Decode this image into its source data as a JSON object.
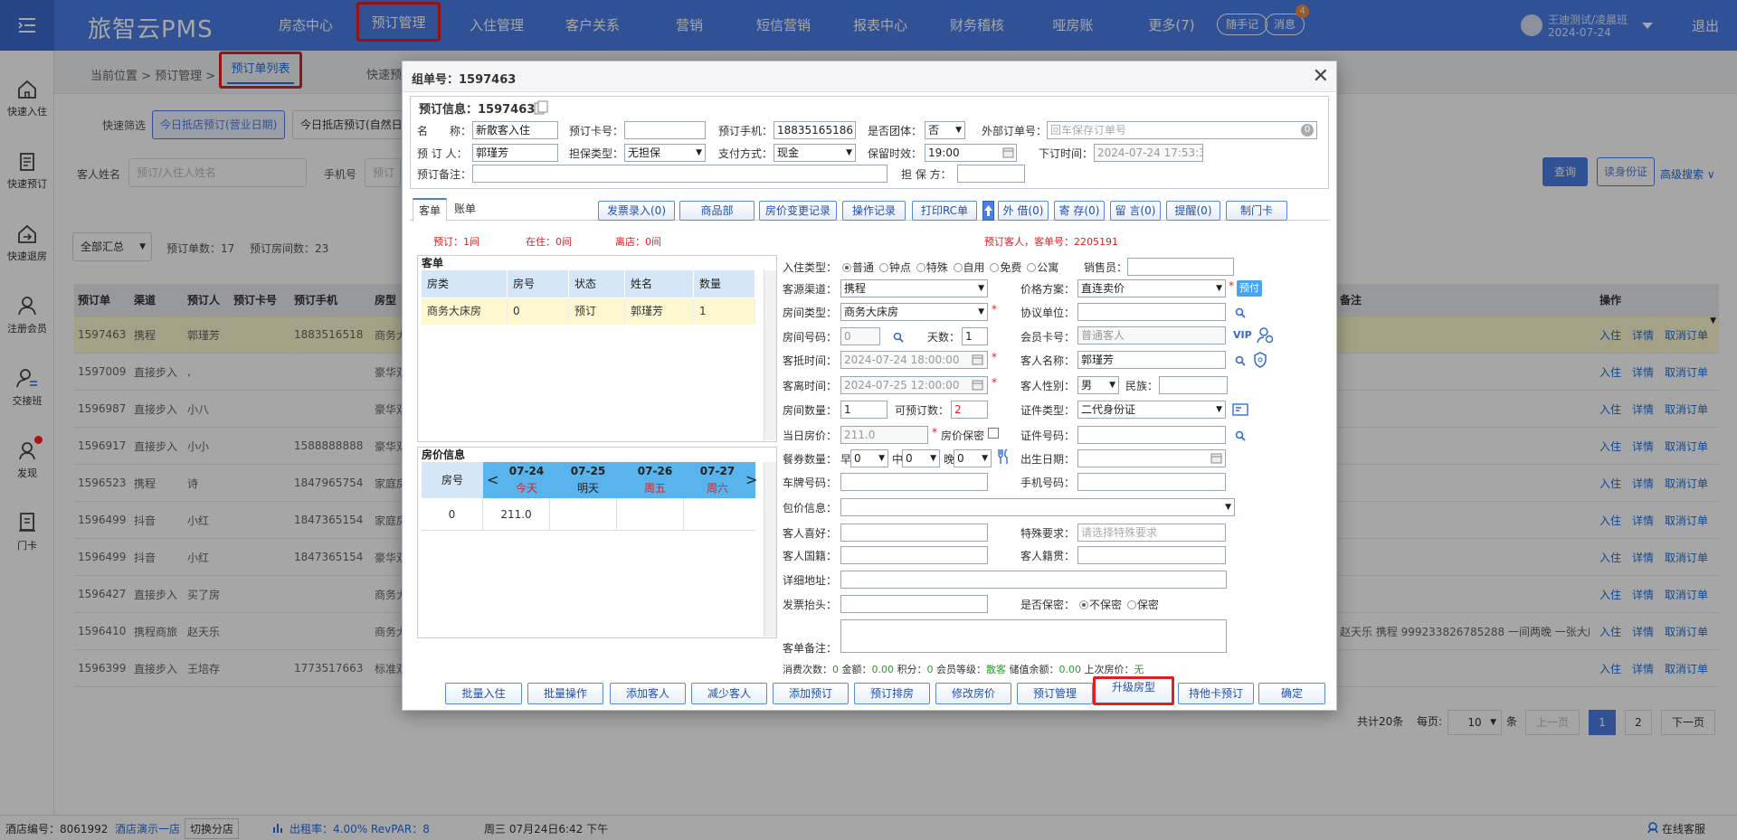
{
  "topbar": {
    "brand": "旅智云PMS",
    "nav": [
      "房态中心",
      "预订管理",
      "入住管理",
      "客户关系",
      "营销",
      "短信营销",
      "报表中心",
      "财务稽核",
      "哑房账",
      "更多(7)"
    ],
    "notes_btn": "随手记",
    "msg_btn": "消息",
    "msg_count": "4",
    "user_name": "王迪测试/凌晨班",
    "user_date": "2024-07-24",
    "logout": "退出"
  },
  "sidebar": {
    "items": [
      "快速入住",
      "快速预订",
      "快速退房",
      "注册会员",
      "交接班",
      "发现",
      "门卡"
    ]
  },
  "crumb": {
    "text": "当前位置 > 预订管理 >",
    "tab_active": "预订单列表",
    "tab2": "快速预"
  },
  "filters": {
    "quick_label": "快速筛选",
    "btn1": "今日抵店预订(营业日期)",
    "btn2": "今日抵店预订(自然日",
    "name_label": "客人姓名",
    "name_ph": "预订/入住人姓名",
    "phone_label": "手机号",
    "phone_ph": "预订",
    "query": "查询",
    "read_id": "读身份证",
    "advanced": "高级搜索 ∨",
    "summary_select": "全部汇总",
    "order_count": "预订单数：17",
    "room_count": "预订房间数：23"
  },
  "table": {
    "headers": [
      "预订单",
      "渠道",
      "预订人",
      "预订卡号",
      "预订手机",
      "房型"
    ],
    "remark_header": "备注",
    "ops_header": "操作",
    "actions": [
      "入住",
      "详情",
      "取消订单"
    ],
    "rows": [
      {
        "id": "1597463",
        "ch": "携程",
        "who": "郭瑾芳",
        "card": "",
        "phone": "18835165186",
        "type": "商务大",
        "remark": ""
      },
      {
        "id": "1597009",
        "ch": "直接步入",
        "who": ",",
        "card": "",
        "phone": "",
        "type": "豪华双",
        "remark": ""
      },
      {
        "id": "1596987",
        "ch": "直接步入",
        "who": "小八",
        "card": "",
        "phone": "",
        "type": "豪华双",
        "remark": ""
      },
      {
        "id": "1596917",
        "ch": "直接步入",
        "who": "小小",
        "card": "",
        "phone": "15888888888",
        "type": "豪华双",
        "remark": ""
      },
      {
        "id": "1596523",
        "ch": "携程",
        "who": "诗",
        "card": "",
        "phone": "18479657542",
        "type": "家庭房",
        "remark": ""
      },
      {
        "id": "1596499",
        "ch": "抖音",
        "who": "小红",
        "card": "",
        "phone": "18473651542",
        "type": "家庭房",
        "remark": ""
      },
      {
        "id": "1596499",
        "ch": "抖音",
        "who": "小红",
        "card": "",
        "phone": "18473651542",
        "type": "豪华双",
        "remark": ""
      },
      {
        "id": "1596427",
        "ch": "直接步入",
        "who": "买了房",
        "card": "",
        "phone": "",
        "type": "商务大",
        "remark": ""
      },
      {
        "id": "1596410",
        "ch": "携程商旅",
        "who": "赵天乐",
        "card": "",
        "phone": "",
        "type": "商务大",
        "remark": "赵天乐 携程 999233826785288 一间两晚 一张大床..."
      },
      {
        "id": "1596399",
        "ch": "直接步入",
        "who": "王培存",
        "card": "",
        "phone": "17735176632",
        "type": "标准双",
        "remark": ""
      }
    ]
  },
  "pager": {
    "total": "共计20条",
    "per_page_label": "每页:",
    "per_page": "10",
    "unit": "条",
    "prev": "上一页",
    "p1": "1",
    "p2": "2",
    "next": "下一页"
  },
  "statusbar": {
    "hotel_id": "酒店编号：8061992",
    "hotel_name": "酒店演示一店",
    "switch": "切换分店",
    "occupancy": "出租率：4.00% RevPAR：8",
    "datetime": "周三 07月24日6:42 下午",
    "service": "在线客服"
  },
  "modal": {
    "title": "组单号：1597463",
    "section_title": "预订信息：1597463",
    "f_name_label": "名　　称：",
    "f_name": "新散客入住",
    "f_card_label": "预订卡号：",
    "f_card": "",
    "f_phone_label": "预订手机：",
    "f_phone": "18835165186",
    "f_group_label": "是否团体：",
    "f_group": "否",
    "f_ext_label": "外部订单号：",
    "f_ext_ph": "回车保存订单号",
    "f_ext_count": "0",
    "f_booker_label": "预 订 人：",
    "f_booker": "郭瑾芳",
    "f_guar_label": "担保类型：",
    "f_guar": "无担保",
    "f_pay_label": "支付方式：",
    "f_pay": "现金",
    "f_keep_label": "保留时效：",
    "f_keep": "19:00",
    "f_ordertime_label": "下订时间：",
    "f_ordertime": "2024-07-24 17:53:3",
    "f_remark_label": "预订备注：",
    "f_guarantor_label": "担 保 方：",
    "tabs": [
      "客单",
      "账单"
    ],
    "toolbar": [
      "发票录入(0)",
      "商品部",
      "房价变更记录",
      "操作记录",
      "打印RC单",
      "外 借(0)",
      "寄 存(0)",
      "留 言(0)",
      "提醒(0)",
      "制门卡"
    ],
    "counts": {
      "booked": "预订：1间",
      "inhouse": "在住：0间",
      "left": "离店：0间",
      "guest_no": "预订客人，客单号：2205191"
    },
    "guest_panel_title": "客单",
    "guest_headers": [
      "房类",
      "房号",
      "状态",
      "姓名",
      "数量"
    ],
    "guest_row": [
      "商务大床房",
      "0",
      "预订",
      "郭瑾芳",
      "1"
    ],
    "price_panel_title": "房价信息",
    "price_head": {
      "room": "房号",
      "d1": "07-24",
      "d1s": "今天",
      "d2": "07-25",
      "d2s": "明天",
      "d3": "07-26",
      "d3s": "周五",
      "d4": "07-27",
      "d4s": "周六"
    },
    "price_row": {
      "room": "0",
      "p1": "211.0"
    },
    "r": {
      "checkin_type_label": "入住类型：",
      "checkin_types": [
        "普通",
        "钟点",
        "特殊",
        "自用",
        "免费",
        "公寓"
      ],
      "sales_label": "销售员：",
      "source_label": "客源渠道：",
      "source": "携程",
      "plan_label": "价格方案：",
      "plan": "直连卖价",
      "prepay": "预付",
      "roomtype_label": "房间类型：",
      "roomtype": "商务大床房",
      "corp_label": "协议单位：",
      "roomno_label": "房间号码：",
      "roomno": "0",
      "days_label": "天数：",
      "days": "1",
      "member_label": "会员卡号：",
      "member_ph": "普通客人",
      "arrive_label": "客抵时间：",
      "arrive": "2024-07-24 18:00:00",
      "gname_label": "客人名称：",
      "gname": "郭瑾芳",
      "depart_label": "客离时间：",
      "depart": "2024-07-25 12:00:00",
      "gender_label": "客人性别：",
      "gender": "男",
      "ethnic_label": "民族：",
      "rooms_label": "房间数量：",
      "rooms": "1",
      "avail_label": "可预订数：",
      "avail": "2",
      "idtype_label": "证件类型：",
      "idtype": "二代身份证",
      "dayprice_label": "当日房价：",
      "dayprice": "211.0",
      "secret_price_label": "房价保密",
      "idno_label": "证件号码：",
      "meal_label": "餐券数量：",
      "breakfast": "早",
      "b_val": "0",
      "lunch": "中",
      "l_val": "0",
      "dinner": "晚",
      "d_val": "0",
      "birthday_label": "出生日期：",
      "plate_label": "车牌号码：",
      "mobile_label": "手机号码：",
      "package_label": "包价信息：",
      "hobby_label": "客人喜好：",
      "special_label": "特殊要求：",
      "special_ph": "请选择特殊要求",
      "nation_label": "客人国籍：",
      "origin_label": "客人籍贯：",
      "address_label": "详细地址：",
      "invoice_label": "发票抬头：",
      "secret_label": "是否保密：",
      "not_secret": "不保密",
      "secret": "保密",
      "remark_label": "客单备注："
    },
    "footinfo": {
      "a": "消费次数：",
      "a_v": "0",
      "b": "金额：",
      "b_v": "0.00",
      "c": "积分：",
      "c_v": "0",
      "d": "会员等级：",
      "d_v": "散客",
      "e": "储值余额：",
      "e_v": "0.00",
      "f": "上次房价：",
      "f_v": "无"
    },
    "buttons": [
      "批量入住",
      "批量操作",
      "添加客人",
      "减少客人",
      "添加预订",
      "预订排房",
      "修改房价",
      "预订管理",
      "升级房型",
      "持他卡预订",
      "确定"
    ]
  }
}
